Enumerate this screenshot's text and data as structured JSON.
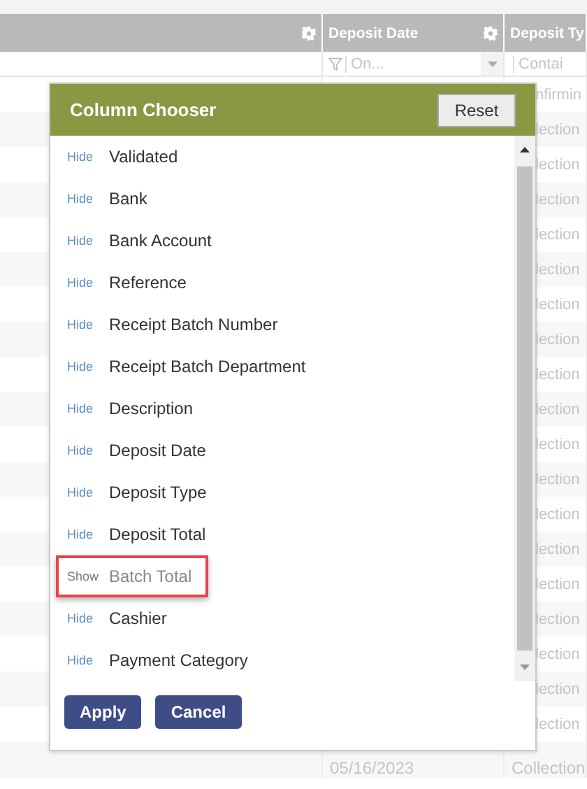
{
  "table": {
    "columns": [
      {
        "kind": "blank"
      },
      {
        "kind": "text",
        "label": "Deposit Date"
      },
      {
        "kind": "text",
        "label": "Deposit Ty"
      }
    ],
    "filters": [
      {
        "placeholder": "On..."
      },
      {
        "placeholder": "Contai"
      }
    ],
    "rows": [
      {
        "kind": "covered",
        "type": "nfirmin"
      },
      {
        "kind": "covered",
        "type": "lection"
      },
      {
        "kind": "covered",
        "type": "lection"
      },
      {
        "kind": "covered",
        "type": "lection"
      },
      {
        "kind": "covered",
        "type": "lection"
      },
      {
        "kind": "covered",
        "type": "lection"
      },
      {
        "kind": "covered",
        "type": "lection"
      },
      {
        "kind": "covered",
        "type": "lection"
      },
      {
        "kind": "covered",
        "type": "lection"
      },
      {
        "kind": "covered",
        "type": "lection"
      },
      {
        "kind": "covered",
        "type": "lection"
      },
      {
        "kind": "covered",
        "type": "lection"
      },
      {
        "kind": "covered",
        "type": "lection"
      },
      {
        "kind": "covered",
        "type": "lection"
      },
      {
        "kind": "covered",
        "type": "lection"
      },
      {
        "kind": "covered",
        "type": "lection"
      },
      {
        "kind": "covered",
        "type": "lection"
      },
      {
        "kind": "covered",
        "type": "lection"
      },
      {
        "kind": "covered",
        "type": "lection"
      },
      {
        "kind": "full",
        "date": "05/16/2023",
        "type": "Collection"
      }
    ]
  },
  "column_chooser": {
    "title": "Column Chooser",
    "reset": "Reset",
    "items": [
      {
        "toggle": "Hide",
        "label": "Validated",
        "shown": true,
        "highlighted": false
      },
      {
        "toggle": "Hide",
        "label": "Bank",
        "shown": true,
        "highlighted": false
      },
      {
        "toggle": "Hide",
        "label": "Bank Account",
        "shown": true,
        "highlighted": false
      },
      {
        "toggle": "Hide",
        "label": "Reference",
        "shown": true,
        "highlighted": false
      },
      {
        "toggle": "Hide",
        "label": "Receipt Batch Number",
        "shown": true,
        "highlighted": false
      },
      {
        "toggle": "Hide",
        "label": "Receipt Batch Department",
        "shown": true,
        "highlighted": false
      },
      {
        "toggle": "Hide",
        "label": "Description",
        "shown": true,
        "highlighted": false
      },
      {
        "toggle": "Hide",
        "label": "Deposit Date",
        "shown": true,
        "highlighted": false
      },
      {
        "toggle": "Hide",
        "label": "Deposit Type",
        "shown": true,
        "highlighted": false
      },
      {
        "toggle": "Hide",
        "label": "Deposit Total",
        "shown": true,
        "highlighted": false
      },
      {
        "toggle": "Show",
        "label": "Batch Total",
        "shown": false,
        "highlighted": true
      },
      {
        "toggle": "Hide",
        "label": "Cashier",
        "shown": true,
        "highlighted": false
      },
      {
        "toggle": "Hide",
        "label": "Payment Category",
        "shown": true,
        "highlighted": false
      }
    ],
    "buttons": [
      "Apply",
      "Cancel"
    ]
  }
}
